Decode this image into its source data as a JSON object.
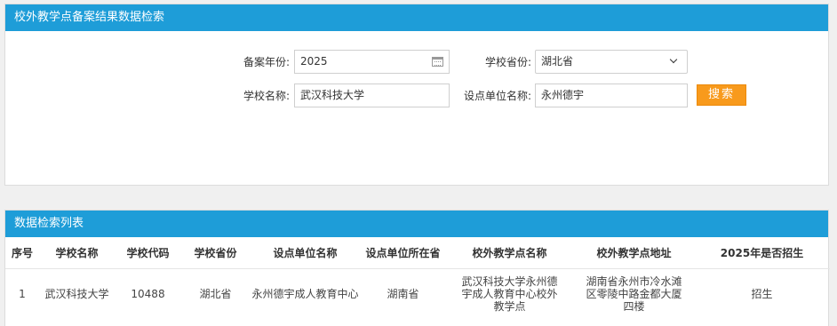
{
  "search_panel": {
    "title": "校外教学点备案结果数据检索",
    "year_label": "备案年份:",
    "year_value": "2025",
    "province_label": "学校省份:",
    "province_value": "湖北省",
    "school_label": "学校名称:",
    "school_value": "武汉科技大学",
    "unit_label": "设点单位名称:",
    "unit_value": "永州德宇",
    "search_button": "搜索"
  },
  "results_panel": {
    "title": "数据检索列表",
    "columns": [
      "序号",
      "学校名称",
      "学校代码",
      "学校省份",
      "设点单位名称",
      "设点单位所在省",
      "校外教学点名称",
      "校外教学点地址",
      "2025年是否招生"
    ],
    "rows": [
      [
        "1",
        "武汉科技大学",
        "10488",
        "湖北省",
        "永州德宇成人教育中心",
        "湖南省",
        "武汉科技大学永州德宇成人教育中心校外教学点",
        "湖南省永州市冷水滩区零陵中路金都大厦四楼",
        "招生"
      ]
    ]
  },
  "colors": {
    "header_blue": "#1e9dd8",
    "button_orange": "#f89a1c"
  }
}
